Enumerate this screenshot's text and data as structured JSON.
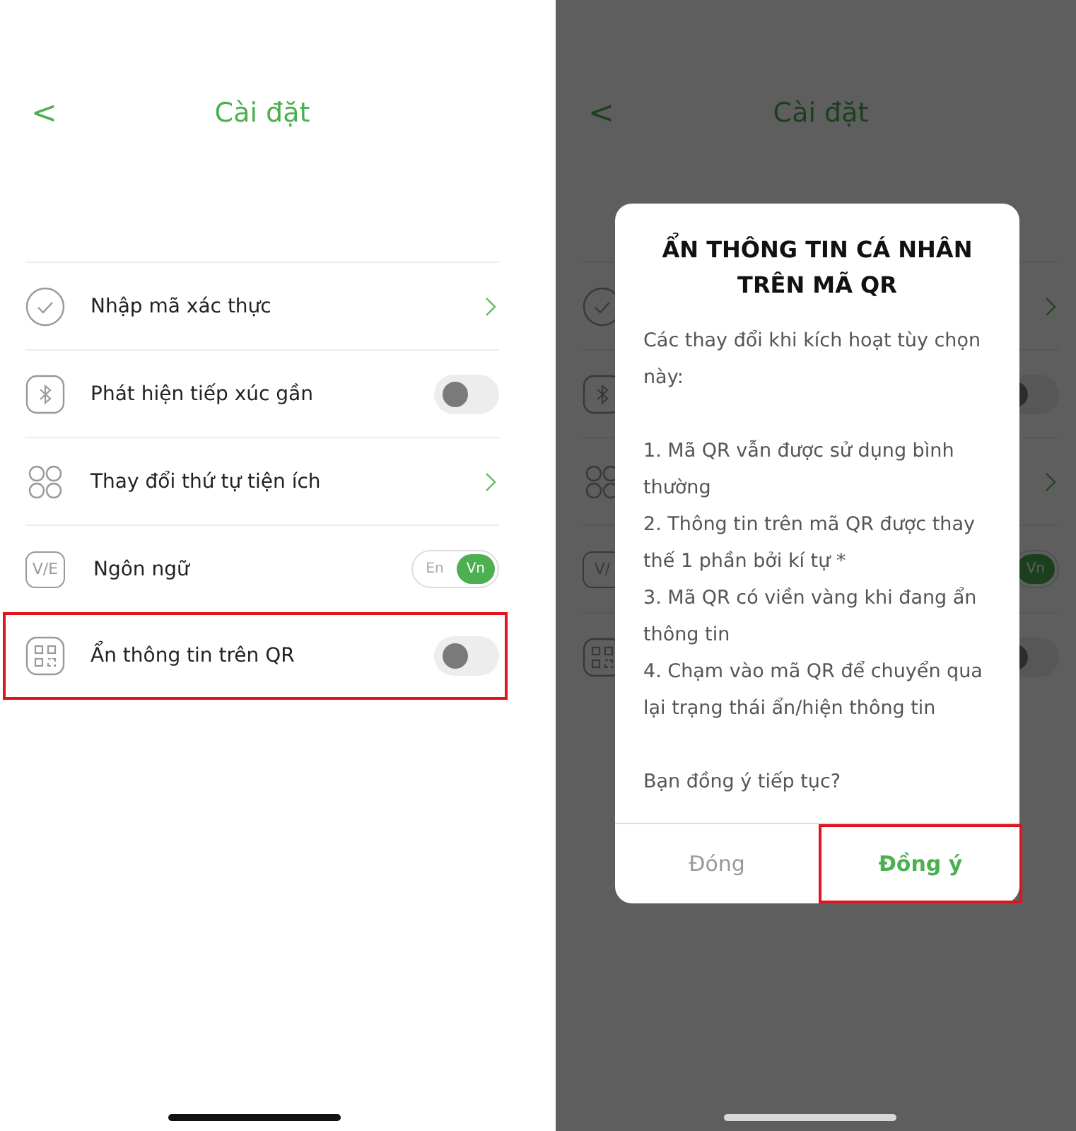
{
  "screens": [
    {
      "back": "<",
      "title": "Cài đặt",
      "dimmed": false,
      "rows": [
        {
          "label": "Nhập mã xác thực",
          "kind": "link",
          "highlighted": false
        },
        {
          "label": "Phát hiện tiếp xúc gần",
          "kind": "toggle",
          "on": false,
          "highlighted": false
        },
        {
          "label": "Thay đổi thứ tự tiện ích",
          "kind": "link",
          "highlighted": false
        },
        {
          "icon_text": "V/E",
          "label": "Ngôn ngữ",
          "kind": "language",
          "options": [
            {
              "label": "En",
              "selected": false
            },
            {
              "label": "Vn",
              "selected": true
            }
          ],
          "highlighted": false
        },
        {
          "label": "Ẩn thông tin trên QR",
          "kind": "toggle",
          "on": false,
          "highlighted": true
        }
      ]
    },
    {
      "back": "<",
      "title": "Cài đặt",
      "dimmed": true,
      "rows": [
        {
          "kind": "link",
          "highlighted": false
        },
        {
          "kind": "toggle",
          "on": false,
          "highlighted": false
        },
        {
          "kind": "link",
          "highlighted": false
        },
        {
          "icon_text": "V/",
          "kind": "language",
          "options": [
            {
              "label": "Vn",
              "selected": true
            }
          ],
          "highlighted": false
        },
        {
          "kind": "toggle",
          "on": false,
          "highlighted": false
        }
      ],
      "dialog": {
        "title": "ẨN THÔNG TIN CÁ NHÂN TRÊN MÃ QR",
        "intro": "Các thay đổi khi kích hoạt tùy chọn này:",
        "items": [
          "1. Mã QR vẫn được sử dụng bình thường",
          "2. Thông tin trên mã QR được thay thế 1 phần bởi kí tự *",
          "3. Mã QR có viền vàng khi đang ẩn thông tin",
          "4. Chạm vào mã QR để chuyển qua lại trạng thái ẩn/hiện thông tin"
        ],
        "question": "Bạn đồng ý tiếp tục?",
        "buttons": [
          {
            "label": "Đóng",
            "kind": "cancel",
            "highlighted": false
          },
          {
            "label": "Đồng ý",
            "kind": "confirm",
            "highlighted": true
          }
        ]
      }
    }
  ]
}
